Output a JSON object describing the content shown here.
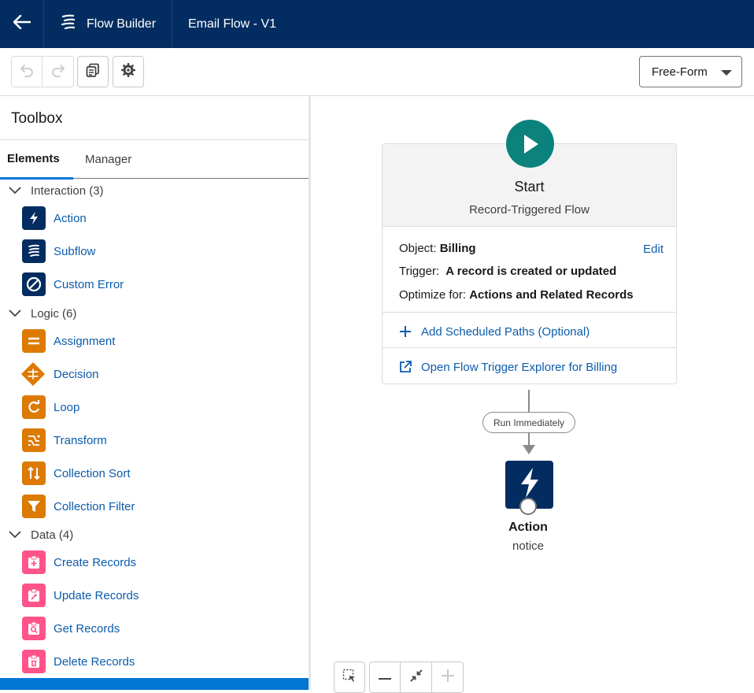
{
  "header": {
    "back_icon": "arrow-left-icon",
    "app_icon": "flow-icon",
    "app_title": "Flow Builder",
    "flow_name": "Email Flow - V1"
  },
  "toolbar": {
    "undo_icon": "undo-icon",
    "redo_icon": "redo-icon",
    "copy_icon": "copy-icon",
    "settings_icon": "gear-icon",
    "mode_value": "Free-Form"
  },
  "toolbox": {
    "title": "Toolbox",
    "tabs": [
      {
        "label": "Elements",
        "active": true
      },
      {
        "label": "Manager",
        "active": false
      }
    ],
    "sections": [
      {
        "label": "Interaction (3)",
        "items": [
          {
            "label": "Action",
            "icon": "lightning-icon",
            "color": "#032d60"
          },
          {
            "label": "Subflow",
            "icon": "flow-icon",
            "color": "#032d60"
          },
          {
            "label": "Custom Error",
            "icon": "ban-icon",
            "color": "#032d60"
          }
        ]
      },
      {
        "label": "Logic (6)",
        "items": [
          {
            "label": "Assignment",
            "icon": "assignment-icon",
            "color": "#dd7a01"
          },
          {
            "label": "Decision",
            "icon": "decision-icon",
            "color": "#dd7a01"
          },
          {
            "label": "Loop",
            "icon": "loop-icon",
            "color": "#dd7a01"
          },
          {
            "label": "Transform",
            "icon": "transform-icon",
            "color": "#dd7a01"
          },
          {
            "label": "Collection Sort",
            "icon": "sort-icon",
            "color": "#dd7a01"
          },
          {
            "label": "Collection Filter",
            "icon": "filter-icon",
            "color": "#dd7a01"
          }
        ]
      },
      {
        "label": "Data (4)",
        "items": [
          {
            "label": "Create Records",
            "icon": "record-create-icon",
            "color": "#ff538a"
          },
          {
            "label": "Update Records",
            "icon": "record-update-icon",
            "color": "#ff538a"
          },
          {
            "label": "Get Records",
            "icon": "record-lookup-icon",
            "color": "#ff538a"
          },
          {
            "label": "Delete Records",
            "icon": "record-delete-icon",
            "color": "#ff538a"
          }
        ]
      }
    ]
  },
  "canvas": {
    "start": {
      "title": "Start",
      "subtitle": "Record-Triggered Flow",
      "object_label": "Object:",
      "object_value": "Billing",
      "edit_label": "Edit",
      "trigger_label": "Trigger:",
      "trigger_value": "A record is created or updated",
      "optimize_label": "Optimize for:",
      "optimize_value": "Actions and Related Records",
      "add_paths_label": "Add Scheduled Paths (Optional)",
      "explorer_label": "Open Flow Trigger Explorer for Billing"
    },
    "connector_label": "Run Immediately",
    "action_node": {
      "title": "Action",
      "subtitle": "notice"
    },
    "zoom_controls": {
      "select_icon": "marquee-select-icon",
      "zoom_out_icon": "minus-icon",
      "fit_icon": "contract-icon",
      "zoom_in_icon": "plus-icon"
    }
  },
  "colors": {
    "header_bg": "#032d60",
    "link": "#0b5cab",
    "start_green": "#0b827c",
    "logic_orange": "#dd7a01",
    "data_pink": "#ff538a",
    "selection_blue": "#0176d3"
  }
}
